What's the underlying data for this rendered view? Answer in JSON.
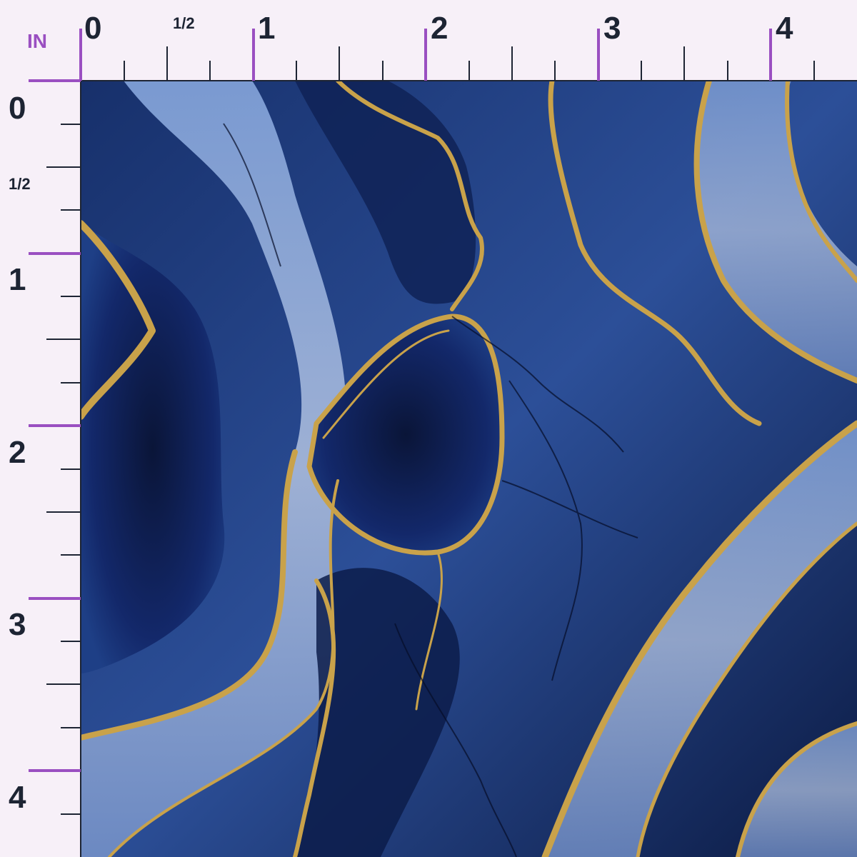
{
  "ruler": {
    "unit_label": "IN",
    "top_labels": [
      "0",
      "1/2",
      "1",
      "2",
      "3",
      "4"
    ],
    "left_labels": [
      "0",
      "1/2",
      "1",
      "2",
      "3",
      "4"
    ]
  },
  "colors": {
    "background": "#f7f0f8",
    "ruler_ink": "#1d2433",
    "ruler_accent": "#9a4fc1",
    "navy_dark": "#0b1a3f",
    "navy": "#1d3a7a",
    "blue_light": "#5a7fc0",
    "blue_pale": "#8fa6d0",
    "gold": "#c9a24a"
  },
  "swatch": {
    "pattern_name": "navy-gold-agate-marble",
    "icon": "fabric-swatch-image"
  }
}
